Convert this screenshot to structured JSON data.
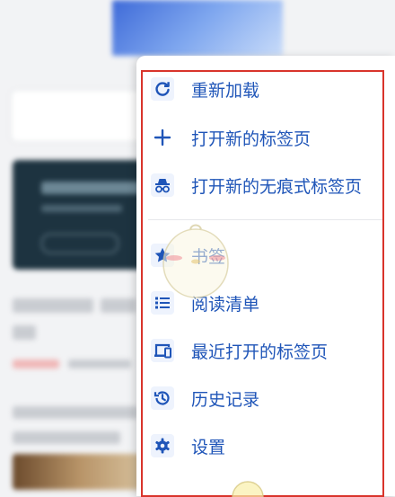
{
  "menu": {
    "items": [
      {
        "label": "重新加载",
        "icon": "reload-icon"
      },
      {
        "label": "打开新的标签页",
        "icon": "plus-icon"
      },
      {
        "label": "打开新的无痕式标签页",
        "icon": "incognito-icon"
      },
      {
        "label": "书签",
        "icon": "star-icon"
      },
      {
        "label": "阅读清单",
        "icon": "list-icon"
      },
      {
        "label": "最近打开的标签页",
        "icon": "devices-icon"
      },
      {
        "label": "历史记录",
        "icon": "history-icon"
      },
      {
        "label": "设置",
        "icon": "gear-icon"
      }
    ]
  },
  "colors": {
    "accent": "#1f55b8",
    "highlight_frame": "#d9342b"
  }
}
